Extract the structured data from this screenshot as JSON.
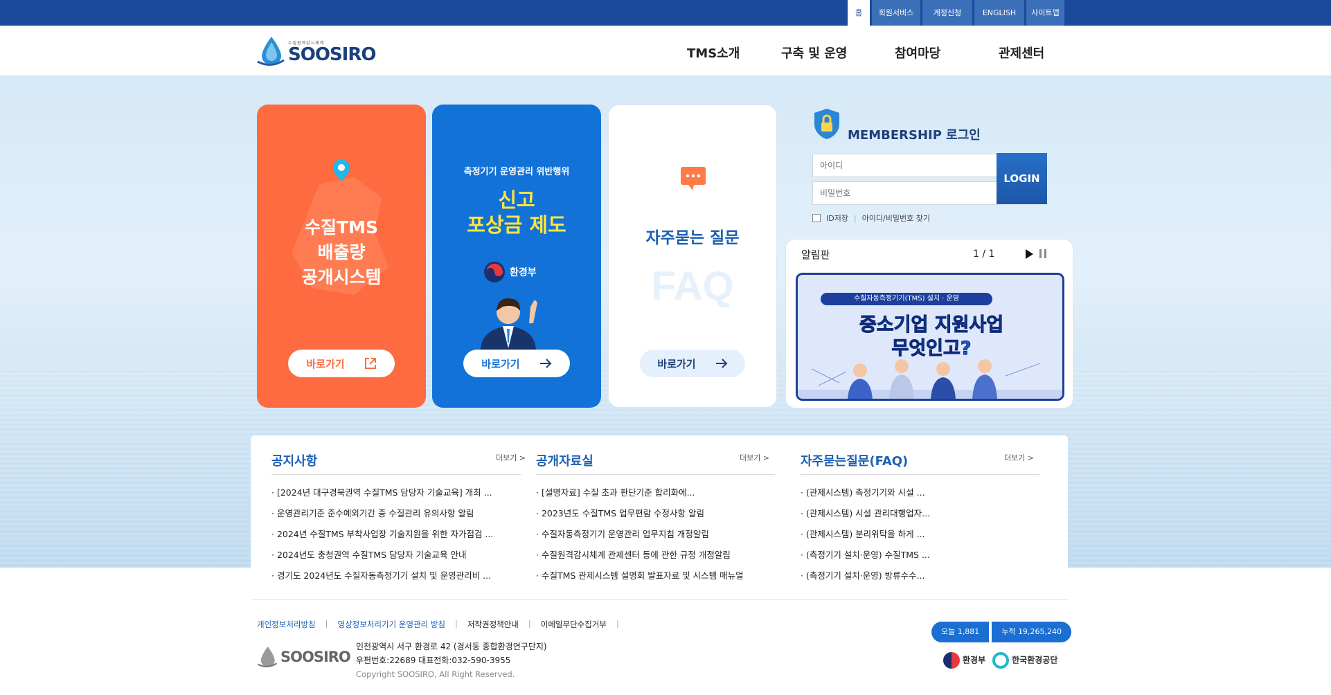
{
  "topbar": {
    "home": "홈",
    "member": "회원서비스",
    "account": "계정신청",
    "english": "ENGLISH",
    "sitemap": "사이트맵"
  },
  "logo": {
    "subtitle": "수질원격감시체계",
    "name": "SOOSIRO"
  },
  "gnb": [
    "TMS소개",
    "구축 및 운영",
    "참여마당",
    "관제센터"
  ],
  "cards": {
    "tms": {
      "line1": "수질TMS",
      "line2": "배출량",
      "line3": "공개시스템",
      "button": "바로가기"
    },
    "report": {
      "subtitle": "측정기기 운영관리 위반행위",
      "line1": "신고",
      "line2": "포상금 제도",
      "org": "환경부",
      "button": "바로가기"
    },
    "faq": {
      "title": "자주묻는 질문",
      "watermark": "FAQ",
      "button": "바로가기"
    }
  },
  "login": {
    "title": "MEMBERSHIP 로그인",
    "id_placeholder": "아이디",
    "pw_placeholder": "비밀번호",
    "button": "LOGIN",
    "save_id": "ID저장",
    "find": "아이디/비밀번호 찾기"
  },
  "board": {
    "title": "알림판",
    "pager": "1 / 1",
    "banner_tag": "수질자동측정기기(TMS) 설치 · 운영",
    "banner_line1": "중소기업 지원사업",
    "banner_line2": "무엇인고?"
  },
  "notice": {
    "title": "공지사항",
    "more": "더보기 >",
    "items": [
      "[2024년 대구경북권역 수질TMS 담당자 기술교육] 개최 ...",
      "운영관리기준 준수예외기간 중 수질관리 유의사항 알림",
      "2024년 수질TMS 부착사업장 기술지원을 위한 자가점검 ...",
      "2024년도 충청권역 수질TMS 담당자 기술교육 안내",
      "경기도 2024년도 수질자동측정기기 설치 및 운영관리비 ..."
    ]
  },
  "archive": {
    "title": "공개자료실",
    "more": "더보기 >",
    "items": [
      "[설명자료] 수질 초과 판단기준 합리화에...",
      "2023년도 수질TMS 업무편람 수정사항 알림",
      "수질자동측정기기 운영관리 업무지침 개정알림",
      "수질원격감시체계 관제센터 등에 관한 규정 개정알림",
      "수질TMS 관제시스템 설명회 발표자료 및 시스템 매뉴얼"
    ]
  },
  "faq": {
    "title": "자주묻는질문(FAQ)",
    "more": "더보기 >",
    "items": [
      "(관제시스템) 측정기기와 시설 ...",
      "(관제시스템) 시설 관리대행업자...",
      "(관제시스템) 분리위탁을 하게 ...",
      "(측정기기 설치·운영) 수질TMS ...",
      "(측정기기 설치·운영) 방류수수..."
    ]
  },
  "footer": {
    "links": [
      "개인정보처리방침",
      "영상정보처리기기 운영관리 방침",
      "저작권정책안내",
      "이메일무단수집거부"
    ],
    "logo": "SOOSIRO",
    "address": "인천광역시 서구 환경로 42 (경서동 종합환경연구단지)",
    "contact": "우편번호:22689 대표전화:032-590-3955",
    "copyright": "Copyright SOOSIRO, All Right Reserved.",
    "today": "오늘 1,881",
    "total": "누적 19,265,240",
    "org1": "환경부",
    "org2": "한국환경공단"
  },
  "colors": {
    "topbar": "#1c4a9a",
    "orange": "#ff6b40",
    "blue": "#1272d8",
    "accent": "#1c5fb5"
  }
}
